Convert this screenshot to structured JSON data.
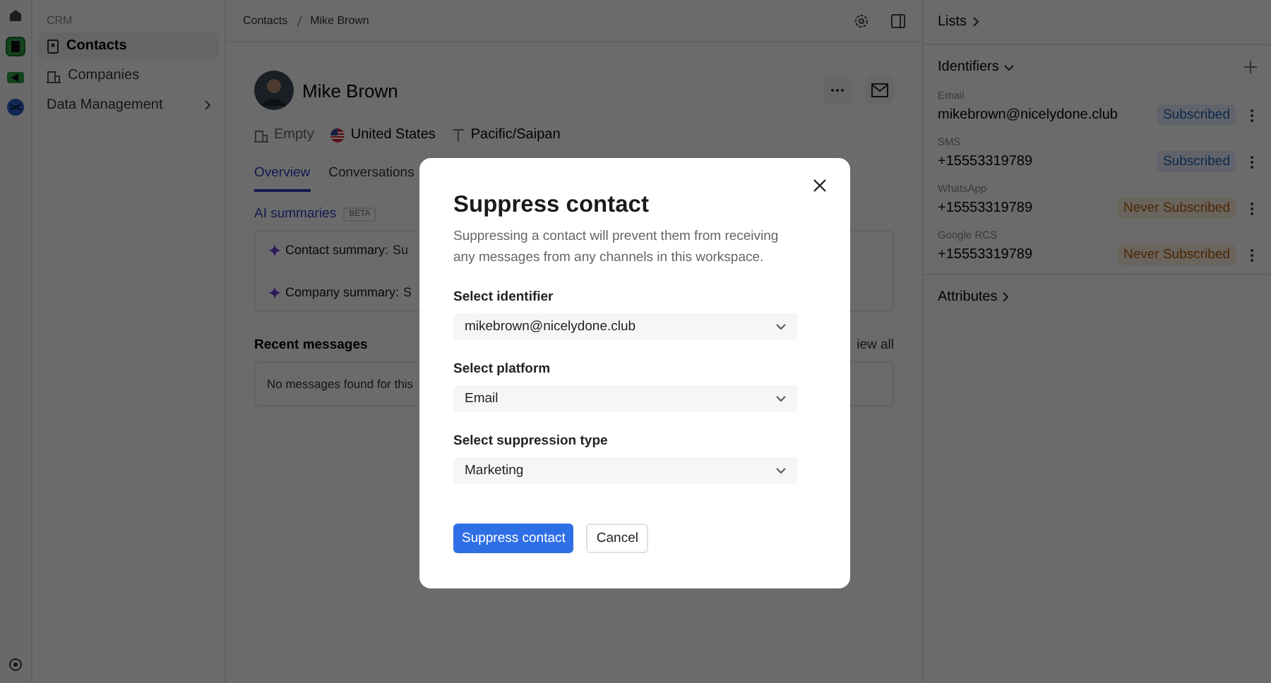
{
  "nav": {
    "section": "CRM",
    "items": [
      {
        "label": "Contacts",
        "kind": "contacts",
        "selected": true
      },
      {
        "label": "Companies",
        "kind": "companies",
        "selected": false
      },
      {
        "label": "Data Management",
        "kind": "group",
        "selected": false
      }
    ]
  },
  "breadcrumb": [
    "Contacts",
    "Mike Brown"
  ],
  "contact": {
    "name": "Mike Brown",
    "company": "Empty",
    "country": "United States",
    "timezone": "Pacific/Saipan"
  },
  "tabs": [
    {
      "label": "Overview",
      "selected": true
    },
    {
      "label": "Conversations",
      "selected": false
    }
  ],
  "ai": {
    "title": "AI summaries",
    "badge": "BETA",
    "rows": [
      {
        "label": "Contact summary:",
        "value": "Su"
      },
      {
        "label": "Company summary:",
        "value": "S"
      }
    ]
  },
  "recent": {
    "title": "Recent messages",
    "link": "iew all",
    "empty": "No messages found for this"
  },
  "side": {
    "lists": "Lists",
    "identifiers_title": "Identifiers",
    "attributes": "Attributes",
    "identifiers": [
      {
        "type": "Email",
        "value": "mikebrown@nicelydone.club",
        "status": "Subscribed",
        "kind": "subscribed"
      },
      {
        "type": "SMS",
        "value": "+15553319789",
        "status": "Subscribed",
        "kind": "subscribed"
      },
      {
        "type": "WhatsApp",
        "value": "+15553319789",
        "status": "Never Subscribed",
        "kind": "never"
      },
      {
        "type": "Google RCS",
        "value": "+15553319789",
        "status": "Never Subscribed",
        "kind": "never"
      }
    ]
  },
  "dialog": {
    "title": "Suppress contact",
    "description": "Suppressing a contact will prevent them from receiving any messages from any channels in this workspace.",
    "fields": [
      {
        "label": "Select identifier",
        "value": "mikebrown@nicelydone.club"
      },
      {
        "label": "Select platform",
        "value": "Email"
      },
      {
        "label": "Select suppression type",
        "value": "Marketing"
      }
    ],
    "primary": "Suppress contact",
    "secondary": "Cancel"
  }
}
